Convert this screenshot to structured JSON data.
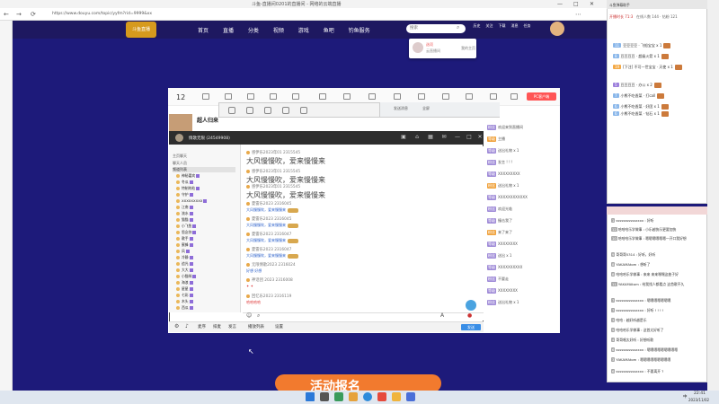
{
  "browser": {
    "title": "斗鱼-直播间0201的直播间 - 网络的云端直播",
    "url": "https://www.douyu.com/topic/yyfm?rid=9999&xx",
    "controls": [
      "—",
      "□",
      "✕"
    ]
  },
  "site": {
    "logo": "斗鱼直播",
    "nav": [
      "首页",
      "直播",
      "分类",
      "视频",
      "游戏",
      "鱼吧",
      "钓鱼服务"
    ],
    "search_placeholder": "搜索",
    "header_icons": [
      "历史",
      "关注",
      "下载",
      "消息",
      "任务"
    ]
  },
  "popup": {
    "name": "选项",
    "sub": "云直播间",
    "right": "我的主页"
  },
  "room": {
    "number": "12",
    "streamer": "超人归来",
    "pc_button": "PC客户端",
    "right_rows": [
      {
        "tag": "粉丝",
        "text": "欢迎来到直播间"
      },
      {
        "tag": "等级",
        "text": "主播",
        "o": true
      },
      {
        "tag": "等级",
        "text": "送出礼物 x 1"
      },
      {
        "tag": "粉丝",
        "text": "发言 ! ! !"
      },
      {
        "tag": "等级",
        "text": "XXXXXXXXX"
      },
      {
        "tag": "粉丝",
        "text": "送出礼物 x 1",
        "o": true
      },
      {
        "tag": "等级",
        "text": "XXXXXXXXXXXX"
      },
      {
        "tag": "粉丝",
        "text": "欢迎光临"
      },
      {
        "tag": "等级",
        "text": "撞击我了"
      },
      {
        "tag": "粉丝",
        "text": "来了来了",
        "o": true
      },
      {
        "tag": "等级",
        "text": "XXXXXXXX"
      },
      {
        "tag": "粉丝",
        "text": "送出 x 1"
      },
      {
        "tag": "等级",
        "text": "XXXXXXXXXX"
      },
      {
        "tag": "粉丝",
        "text": "不要走"
      },
      {
        "tag": "等级",
        "text": "XXXXXXXX"
      },
      {
        "tag": "粉丝",
        "text": "送出礼物 x 1"
      }
    ]
  },
  "inner_window": {
    "title": "发送消息",
    "sub": "全屏"
  },
  "chat": {
    "title": "情歌无限 (24549908)",
    "sidebar_header": "主页聊天",
    "sidebar_header2": "聊天人员",
    "sidebar_tab": "频道列表",
    "members": [
      "神秘嘉宾",
      "冬瓜",
      "特制的粒",
      "守护",
      "XXXXXXXXX",
      "江南",
      "流水",
      "猫猫",
      "小飞鱼",
      "思念你",
      "歌手",
      "蜜蜂",
      "风",
      "冷静",
      "追光",
      "大大",
      "小猫咪",
      "海浪",
      "星星",
      "七彩",
      "木头",
      "西瓜",
      "晨曦",
      "雪花"
    ],
    "messages": [
      {
        "head": "感伊乐2023年01 2315545",
        "type": "big",
        "text": "大风慢慢吹，爱来慢慢来"
      },
      {
        "head": "感伊乐2023年01 2315545",
        "type": "big",
        "text": "大风慢慢吹，爱来慢慢来"
      },
      {
        "head": "感伊乐2023年01 2315545",
        "type": "big",
        "text": "大风慢慢吹，爱来慢慢来"
      },
      {
        "head": "夏雷乐2023 2316045",
        "type": "small",
        "text": "大风慢慢吹，爱来慢慢来"
      },
      {
        "head": "夏雷乐2023 2316045",
        "type": "small",
        "text": "大风慢慢吹，爱来慢慢来"
      },
      {
        "head": "夏雷乐2023 2316047",
        "type": "small",
        "text": "大风慢慢吹，爱来慢慢来"
      },
      {
        "head": "夏雷乐2023 2316047",
        "type": "small",
        "text": "大风慢慢吹，爱来慢慢来"
      },
      {
        "head": "无限情歌2023 2316024",
        "type": "small",
        "text": "好想 好想"
      },
      {
        "head": "神话团 2023 2316008",
        "type": "red",
        "text": "✦ ✦"
      },
      {
        "head": "回忆乐2023 2316119",
        "type": "red",
        "text": "哈哈哈哈"
      }
    ],
    "bottom": [
      "麦序",
      "排麦",
      "发言",
      "播放列表",
      "设置"
    ],
    "send": "发送"
  },
  "banner": "活动报名",
  "danmaku_window": {
    "header": "斗鱼弹幕助手",
    "sub": "开播时长 71:3",
    "sub2": "在线人数 144 · 钻粉 121",
    "items": [
      {
        "lv": "11",
        "text": "豆豆豆豆 · 飞船宝宝 x 1"
      },
      {
        "lv": "8",
        "text": "豆豆豆豆 · 超级火箭 x 1"
      },
      {
        "lv": "19",
        "text": "[下注] 不可一世宝宝 · 天使 x 1",
        "o": true
      },
      {
        "lv": "5",
        "text": "豆豆豆豆 · 办公 x 2",
        "p": true
      },
      {
        "lv": "7",
        "text": "小熊不吃香菜 · 打call"
      },
      {
        "lv": "6",
        "text": "小熊不吃香菜 · 好团 x 1"
      },
      {
        "lv": "6",
        "text": "小熊不吃香菜 · 钻石 x 1"
      }
    ]
  },
  "chat_window": {
    "items": [
      {
        "lv": "1",
        "text": "sssssssssssxxxx : 好听"
      },
      {
        "lv": "12",
        "text": "哈哈哈乐学做事 : 小乐越快乐更要加快"
      },
      {
        "lv": "10",
        "text": "哈哈哈乐学做事 : 嗯嗯嗯嗯嗯嗯一开口我好想"
      },
      {
        "lv": "9",
        "text": "哥哥哥5314 : 好听，好听"
      },
      {
        "lv": "8",
        "text": "YAKAMAtom : 想听了"
      },
      {
        "lv": "8",
        "text": "哈哈哈乐学做事 : 来来 来来嘿嘿这曲子好"
      },
      {
        "lv": "11",
        "text": "YAKAMAtom : 给我找人都看点 这首歌不久"
      },
      {
        "lv": "7",
        "text": "sssssssssssxxxx : 嗯嗯嗯嗯嗯嗯嗯"
      },
      {
        "lv": "7",
        "text": "sssssssssssxxxx : 好听 ! ! ! !"
      },
      {
        "lv": "3",
        "text": "哈哈 : 越好听越是乐"
      },
      {
        "lv": "5",
        "text": "哈哈哈乐学做事 : 这首太好听了"
      },
      {
        "lv": "4",
        "text": "哥哥唱太好听 : 好想听歌"
      },
      {
        "lv": "6",
        "text": "sssssssssssxxxx : 嗯嗯嗯嗯嗯嗯嗯嗯嗯"
      },
      {
        "lv": "3",
        "text": "YAKAMAtom : 嗯嗯嗯嗯嗯嗯嗯嗯嗯"
      },
      {
        "lv": "6",
        "text": "sssssssssssxxxx : 不要离开 ?"
      }
    ]
  },
  "taskbar": {
    "time": "22:41",
    "date": "2023/11/02",
    "lang": "中"
  }
}
